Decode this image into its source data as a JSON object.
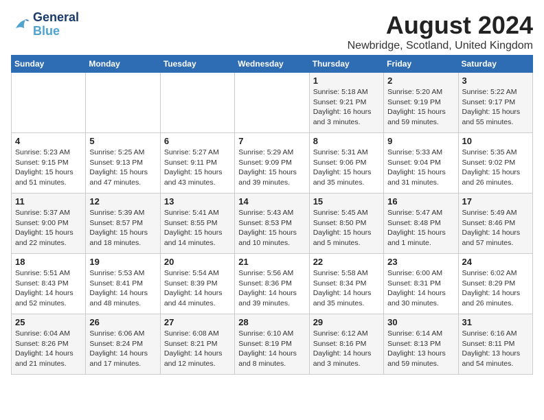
{
  "logo": {
    "line1": "General",
    "line2": "Blue"
  },
  "title": "August 2024",
  "location": "Newbridge, Scotland, United Kingdom",
  "days_header": [
    "Sunday",
    "Monday",
    "Tuesday",
    "Wednesday",
    "Thursday",
    "Friday",
    "Saturday"
  ],
  "weeks": [
    [
      {
        "day": "",
        "info": ""
      },
      {
        "day": "",
        "info": ""
      },
      {
        "day": "",
        "info": ""
      },
      {
        "day": "",
        "info": ""
      },
      {
        "day": "1",
        "info": "Sunrise: 5:18 AM\nSunset: 9:21 PM\nDaylight: 16 hours\nand 3 minutes."
      },
      {
        "day": "2",
        "info": "Sunrise: 5:20 AM\nSunset: 9:19 PM\nDaylight: 15 hours\nand 59 minutes."
      },
      {
        "day": "3",
        "info": "Sunrise: 5:22 AM\nSunset: 9:17 PM\nDaylight: 15 hours\nand 55 minutes."
      }
    ],
    [
      {
        "day": "4",
        "info": "Sunrise: 5:23 AM\nSunset: 9:15 PM\nDaylight: 15 hours\nand 51 minutes."
      },
      {
        "day": "5",
        "info": "Sunrise: 5:25 AM\nSunset: 9:13 PM\nDaylight: 15 hours\nand 47 minutes."
      },
      {
        "day": "6",
        "info": "Sunrise: 5:27 AM\nSunset: 9:11 PM\nDaylight: 15 hours\nand 43 minutes."
      },
      {
        "day": "7",
        "info": "Sunrise: 5:29 AM\nSunset: 9:09 PM\nDaylight: 15 hours\nand 39 minutes."
      },
      {
        "day": "8",
        "info": "Sunrise: 5:31 AM\nSunset: 9:06 PM\nDaylight: 15 hours\nand 35 minutes."
      },
      {
        "day": "9",
        "info": "Sunrise: 5:33 AM\nSunset: 9:04 PM\nDaylight: 15 hours\nand 31 minutes."
      },
      {
        "day": "10",
        "info": "Sunrise: 5:35 AM\nSunset: 9:02 PM\nDaylight: 15 hours\nand 26 minutes."
      }
    ],
    [
      {
        "day": "11",
        "info": "Sunrise: 5:37 AM\nSunset: 9:00 PM\nDaylight: 15 hours\nand 22 minutes."
      },
      {
        "day": "12",
        "info": "Sunrise: 5:39 AM\nSunset: 8:57 PM\nDaylight: 15 hours\nand 18 minutes."
      },
      {
        "day": "13",
        "info": "Sunrise: 5:41 AM\nSunset: 8:55 PM\nDaylight: 15 hours\nand 14 minutes."
      },
      {
        "day": "14",
        "info": "Sunrise: 5:43 AM\nSunset: 8:53 PM\nDaylight: 15 hours\nand 10 minutes."
      },
      {
        "day": "15",
        "info": "Sunrise: 5:45 AM\nSunset: 8:50 PM\nDaylight: 15 hours\nand 5 minutes."
      },
      {
        "day": "16",
        "info": "Sunrise: 5:47 AM\nSunset: 8:48 PM\nDaylight: 15 hours\nand 1 minute."
      },
      {
        "day": "17",
        "info": "Sunrise: 5:49 AM\nSunset: 8:46 PM\nDaylight: 14 hours\nand 57 minutes."
      }
    ],
    [
      {
        "day": "18",
        "info": "Sunrise: 5:51 AM\nSunset: 8:43 PM\nDaylight: 14 hours\nand 52 minutes."
      },
      {
        "day": "19",
        "info": "Sunrise: 5:53 AM\nSunset: 8:41 PM\nDaylight: 14 hours\nand 48 minutes."
      },
      {
        "day": "20",
        "info": "Sunrise: 5:54 AM\nSunset: 8:39 PM\nDaylight: 14 hours\nand 44 minutes."
      },
      {
        "day": "21",
        "info": "Sunrise: 5:56 AM\nSunset: 8:36 PM\nDaylight: 14 hours\nand 39 minutes."
      },
      {
        "day": "22",
        "info": "Sunrise: 5:58 AM\nSunset: 8:34 PM\nDaylight: 14 hours\nand 35 minutes."
      },
      {
        "day": "23",
        "info": "Sunrise: 6:00 AM\nSunset: 8:31 PM\nDaylight: 14 hours\nand 30 minutes."
      },
      {
        "day": "24",
        "info": "Sunrise: 6:02 AM\nSunset: 8:29 PM\nDaylight: 14 hours\nand 26 minutes."
      }
    ],
    [
      {
        "day": "25",
        "info": "Sunrise: 6:04 AM\nSunset: 8:26 PM\nDaylight: 14 hours\nand 21 minutes."
      },
      {
        "day": "26",
        "info": "Sunrise: 6:06 AM\nSunset: 8:24 PM\nDaylight: 14 hours\nand 17 minutes."
      },
      {
        "day": "27",
        "info": "Sunrise: 6:08 AM\nSunset: 8:21 PM\nDaylight: 14 hours\nand 12 minutes."
      },
      {
        "day": "28",
        "info": "Sunrise: 6:10 AM\nSunset: 8:19 PM\nDaylight: 14 hours\nand 8 minutes."
      },
      {
        "day": "29",
        "info": "Sunrise: 6:12 AM\nSunset: 8:16 PM\nDaylight: 14 hours\nand 3 minutes."
      },
      {
        "day": "30",
        "info": "Sunrise: 6:14 AM\nSunset: 8:13 PM\nDaylight: 13 hours\nand 59 minutes."
      },
      {
        "day": "31",
        "info": "Sunrise: 6:16 AM\nSunset: 8:11 PM\nDaylight: 13 hours\nand 54 minutes."
      }
    ]
  ]
}
